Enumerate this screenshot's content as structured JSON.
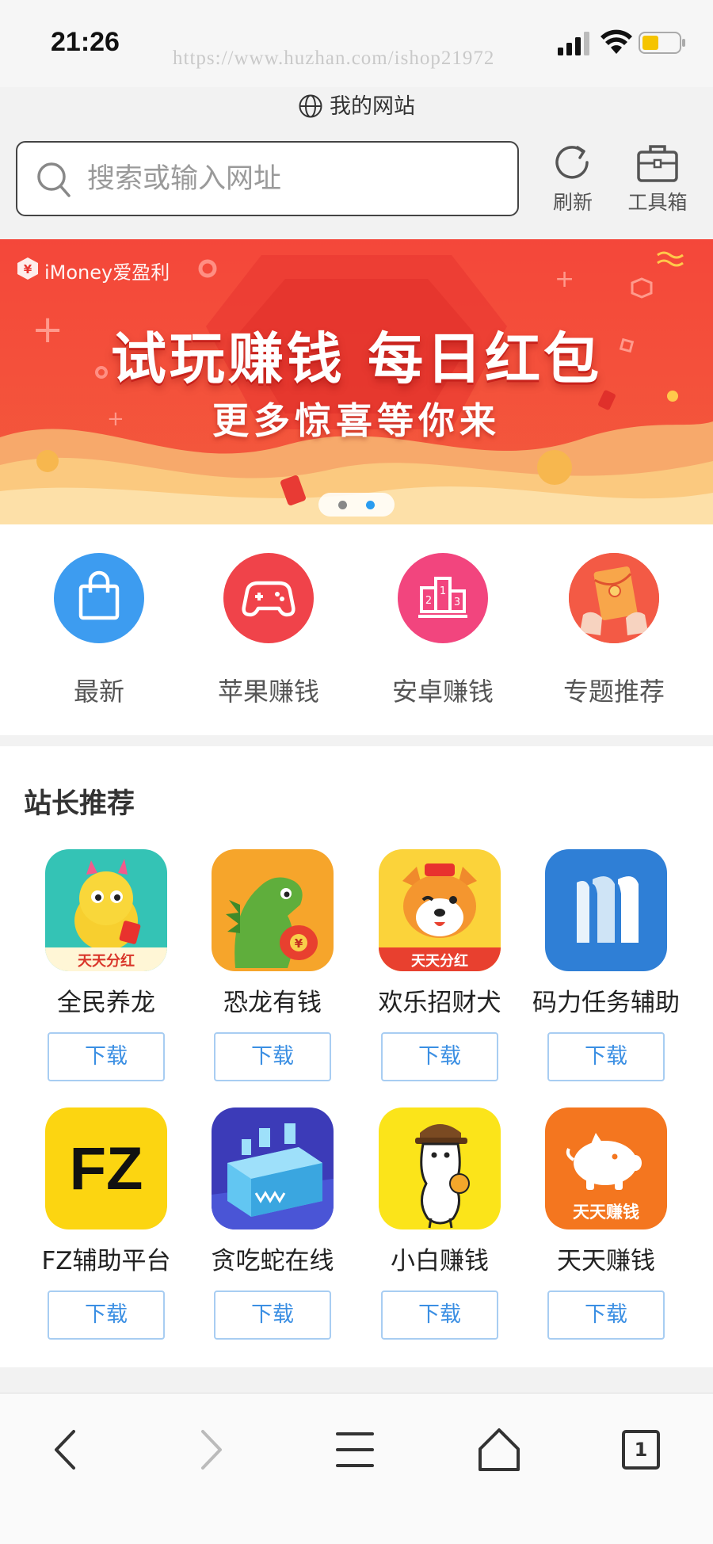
{
  "status_bar": {
    "time": "21:26",
    "watermark": "https://www.huzhan.com/ishop21972",
    "battery_level": 0.45
  },
  "site": {
    "label": "我的网站"
  },
  "search": {
    "placeholder": "搜索或输入网址"
  },
  "toolbar": {
    "refresh_label": "刷新",
    "toolbox_label": "工具箱"
  },
  "banner": {
    "brand": "iMoney爱盈利",
    "title": "试玩赚钱 每日红包",
    "subtitle": "更多惊喜等你来",
    "active_slide": 2,
    "slide_count": 2
  },
  "categories": [
    {
      "label": "最新",
      "icon": "shopping-bag-icon",
      "color": "#3d9cf0"
    },
    {
      "label": "苹果赚钱",
      "icon": "gamepad-icon",
      "color": "#f0434a"
    },
    {
      "label": "安卓赚钱",
      "icon": "podium-icon",
      "color": "#f2457e"
    },
    {
      "label": "专题推荐",
      "icon": "red-envelope-icon",
      "color": "#f25543"
    }
  ],
  "recommendations": {
    "title": "站长推荐",
    "download_label": "下载",
    "apps": [
      {
        "name": "全民养龙",
        "icon": "yellow-dragon-icon",
        "icon_text": "天天分红"
      },
      {
        "name": "恐龙有钱",
        "icon": "green-dinosaur-icon",
        "icon_text": ""
      },
      {
        "name": "欢乐招财犬",
        "icon": "shiba-dog-icon",
        "icon_text": "天天分红"
      },
      {
        "name": "码力任务辅助",
        "icon": "mali-logo-icon",
        "icon_text": ""
      },
      {
        "name": "FZ辅助平台",
        "icon": "fz-logo-icon",
        "icon_text": "FZ"
      },
      {
        "name": "贪吃蛇在线",
        "icon": "snake-game-icon",
        "icon_text": ""
      },
      {
        "name": "小白赚钱",
        "icon": "peanut-character-icon",
        "icon_text": ""
      },
      {
        "name": "天天赚钱",
        "icon": "piggy-bank-icon",
        "icon_text": "天天赚钱"
      }
    ]
  },
  "bottom_nav": {
    "tabs_count": "1"
  }
}
